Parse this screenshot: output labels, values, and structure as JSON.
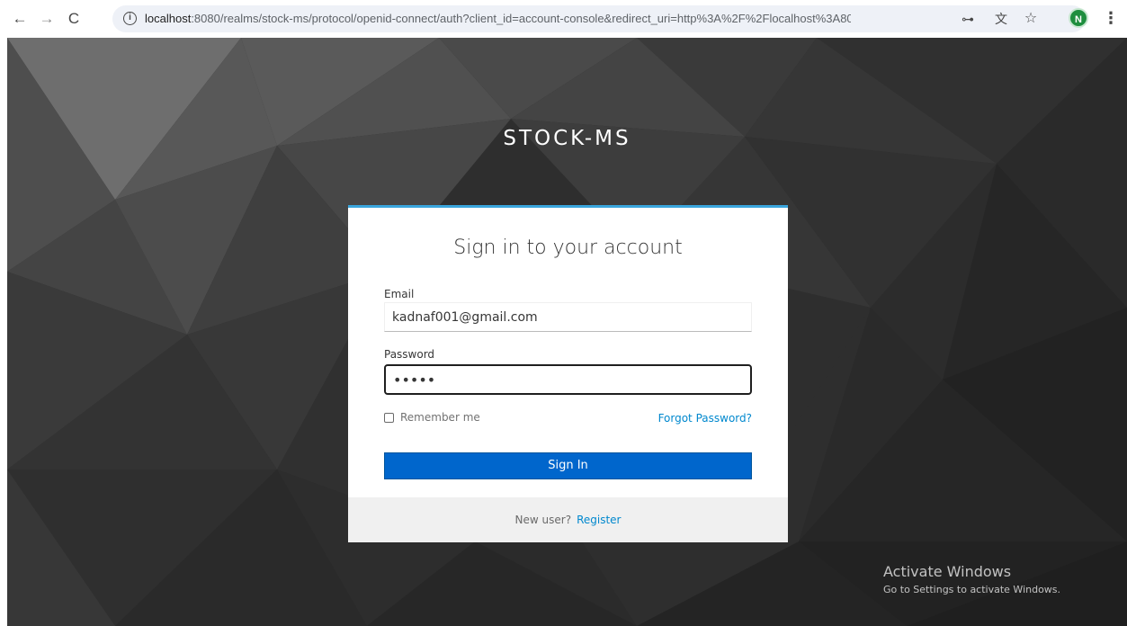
{
  "browser": {
    "url_host": "localhost",
    "url_rest": ":8080/realms/stock-ms/protocol/openid-connect/auth?client_id=account-console&redirect_uri=http%3A%2F%2Flocalhost%3A8080%2Freal...",
    "profile_initial": "N"
  },
  "icons": {
    "back": "←",
    "forward": "→",
    "reload": "C",
    "info": "i",
    "key": "⊶",
    "translate": "文",
    "star": "☆",
    "menu": "⋮"
  },
  "realm": {
    "name": "STOCK-MS"
  },
  "login": {
    "title": "Sign in to your account",
    "email_label": "Email",
    "email_value": "kadnaf001@gmail.com",
    "password_label": "Password",
    "password_value": "•••••",
    "remember_label": "Remember me",
    "forgot_label": "Forgot Password?",
    "signin_label": "Sign In",
    "new_user_label": "New user?",
    "register_label": "Register"
  },
  "watermark": {
    "title": "Activate Windows",
    "subtitle": "Go to Settings to activate Windows."
  },
  "colors": {
    "accent_top_border": "#39a5dc",
    "primary_button": "#0066cc",
    "link": "#0088ce",
    "avatar": "#1e8e3e"
  }
}
